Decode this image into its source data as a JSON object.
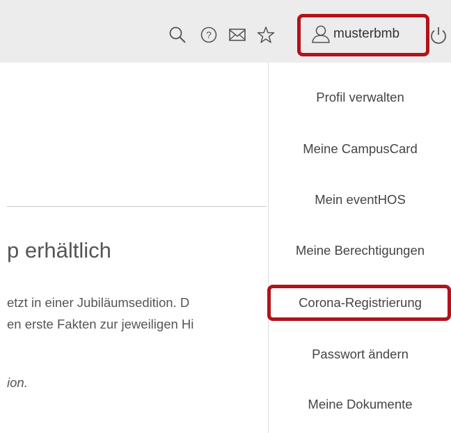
{
  "header": {
    "username": "musterbmb",
    "icons": [
      "search-icon",
      "help-icon",
      "mail-icon",
      "star-icon",
      "user-icon",
      "power-icon"
    ]
  },
  "content": {
    "heading": "p erhältlich",
    "line1": "etzt in einer Jubiläumsedition. D",
    "line2": "en erste Fakten zur jeweiligen Hi",
    "line3": "ion."
  },
  "menu": {
    "items": [
      {
        "label": "Profil verwalten"
      },
      {
        "label": "Meine CampusCard"
      },
      {
        "label": "Mein eventHOS"
      },
      {
        "label": "Meine Berechtigungen"
      },
      {
        "label": "Corona-Registrierung"
      },
      {
        "label": "Passwort ändern"
      },
      {
        "label": "Meine Dokumente"
      }
    ]
  },
  "colors": {
    "highlight": "#b3121b",
    "header_bg": "#ececec",
    "text": "#555555"
  }
}
